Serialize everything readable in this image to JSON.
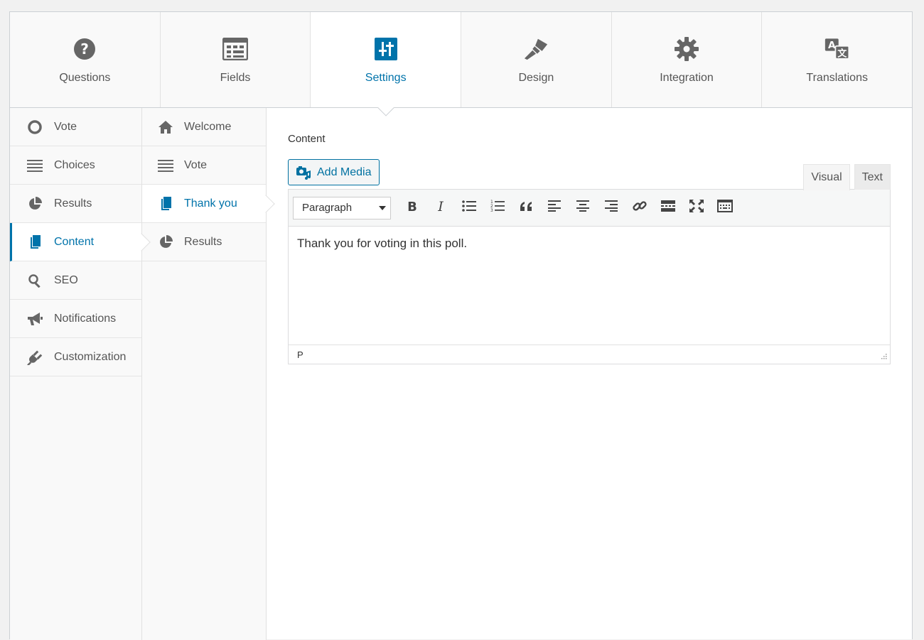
{
  "top_tabs": [
    {
      "label": "Questions",
      "icon": "question-circle-icon"
    },
    {
      "label": "Fields",
      "icon": "fields-table-icon"
    },
    {
      "label": "Settings",
      "icon": "settings-sliders-icon",
      "active": true
    },
    {
      "label": "Design",
      "icon": "brush-icon"
    },
    {
      "label": "Integration",
      "icon": "gear-icon"
    },
    {
      "label": "Translations",
      "icon": "translation-icon"
    }
  ],
  "left_menu": [
    {
      "label": "Vote",
      "icon": "circle-icon"
    },
    {
      "label": "Choices",
      "icon": "list-icon"
    },
    {
      "label": "Results",
      "icon": "pie-chart-icon"
    },
    {
      "label": "Content",
      "icon": "copy-icon",
      "active": true
    },
    {
      "label": "SEO",
      "icon": "search-icon"
    },
    {
      "label": "Notifications",
      "icon": "megaphone-icon"
    },
    {
      "label": "Customization",
      "icon": "plug-icon"
    }
  ],
  "sub_menu": [
    {
      "label": "Welcome",
      "icon": "home-icon"
    },
    {
      "label": "Vote",
      "icon": "list-icon"
    },
    {
      "label": "Thank you",
      "icon": "copy-icon",
      "active": true
    },
    {
      "label": "Results",
      "icon": "pie-chart-icon"
    }
  ],
  "content": {
    "label": "Content",
    "add_media_label": "Add Media",
    "mode_visual": "Visual",
    "mode_text": "Text",
    "format_value": "Paragraph",
    "body_text": "Thank you for voting in this poll.",
    "status_path": "P"
  },
  "colors": {
    "accent": "#0073aa",
    "icon_gray": "#666666"
  }
}
